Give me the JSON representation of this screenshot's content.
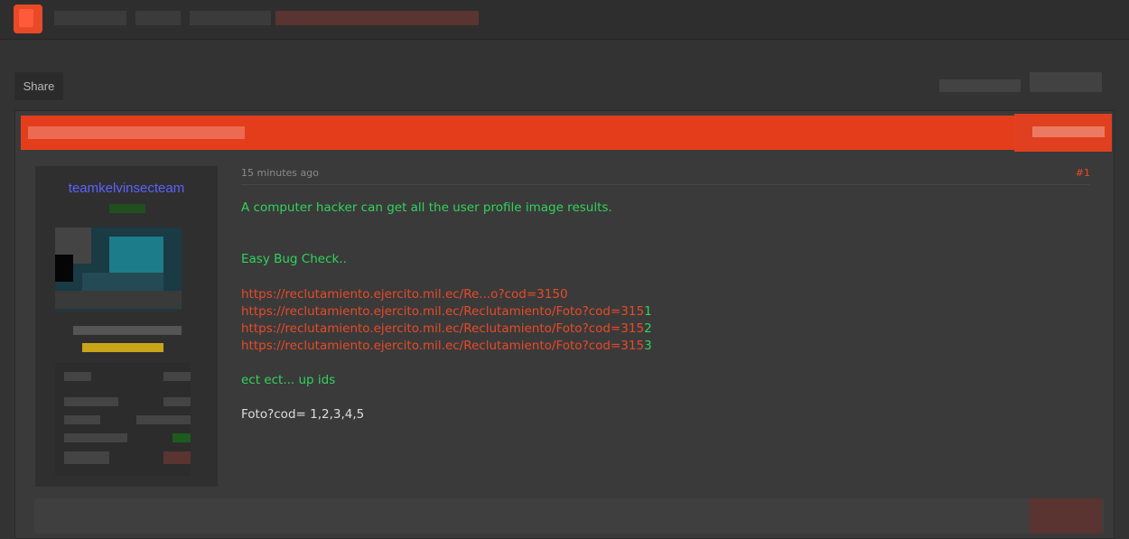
{
  "toolbar": {
    "share_label": "Share"
  },
  "post": {
    "username": "teamkelvinsecteam",
    "timestamp": "15 minutes ago",
    "post_number": "#1",
    "lines": {
      "l1": "A computer hacker can get all the user profile image results.",
      "l2": "Easy Bug Check..",
      "url1": "https://reclutamiento.ejercito.mil.ec/Re...o?cod=3150",
      "url2_prefix": "https://reclutamiento.ejercito.mil.ec/Reclutamiento/Foto?cod=315",
      "url2_suffix": "1",
      "url3_prefix": "https://reclutamiento.ejercito.mil.ec/Reclutamiento/Foto?cod=315",
      "url3_suffix": "2",
      "url4_prefix": "https://reclutamiento.ejercito.mil.ec/Reclutamiento/Foto?cod=315",
      "url4_suffix": "3",
      "l3": "ect ect... up ids",
      "l4": "Foto?cod= 1,2,3,4,5"
    }
  },
  "colors": {
    "accent": "#e84a27",
    "username": "#5c62ff",
    "green_text": "#31d35a"
  }
}
